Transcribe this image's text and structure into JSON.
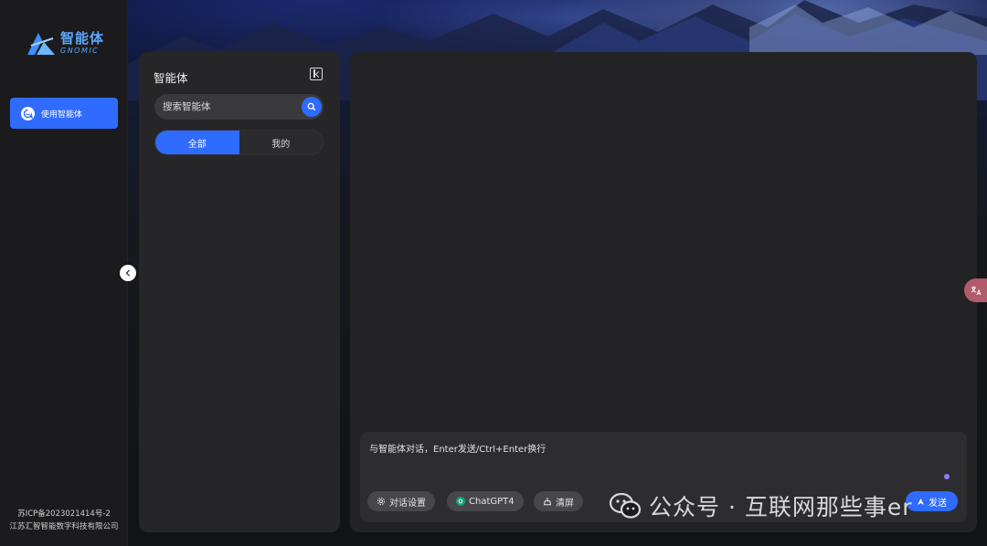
{
  "brand": {
    "name_cn": "智能体",
    "name_en": "GNOMIC"
  },
  "rail": {
    "nav_label": "使用智能体",
    "icp": "苏ICP备2023021414号-2",
    "company": "江苏汇智智能数字科技有限公司"
  },
  "agent_panel": {
    "title": "智能体",
    "search_placeholder": "搜索智能体",
    "tabs": [
      {
        "label": "全部",
        "active": true
      },
      {
        "label": "我的",
        "active": false
      }
    ]
  },
  "composer": {
    "placeholder": "与智能体对话，Enter发送/Ctrl+Enter换行",
    "settings_label": "对话设置",
    "model_label": "ChatGPT4",
    "clear_label": "清屏",
    "send_label": "发送"
  },
  "watermark": {
    "text": "公众号 · 互联网那些事er"
  },
  "colors": {
    "accent": "#2f6bff",
    "rail_bg": "#1b1b1d",
    "panel_bg": "#262628",
    "chat_bg": "#232325"
  }
}
